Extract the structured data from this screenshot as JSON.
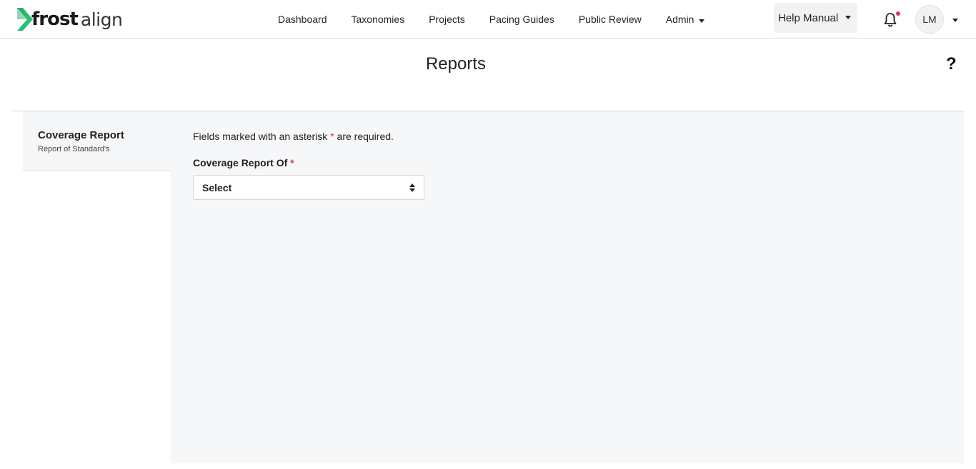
{
  "brand": {
    "name_bold": "frost",
    "name_light": "align",
    "accent_color": "#2bbf73"
  },
  "nav": {
    "items": [
      {
        "label": "Dashboard"
      },
      {
        "label": "Taxonomies"
      },
      {
        "label": "Projects"
      },
      {
        "label": "Pacing Guides"
      },
      {
        "label": "Public Review"
      },
      {
        "label": "Admin"
      }
    ]
  },
  "header": {
    "help_label": "Help Manual",
    "notification_icon": "bell-icon",
    "avatar_initials": "LM"
  },
  "page": {
    "title": "Reports",
    "help_glyph": "?"
  },
  "sidebar": {
    "items": [
      {
        "title": "Coverage Report",
        "subtitle": "Report of Standard's"
      }
    ]
  },
  "form": {
    "note_prefix": "Fields marked with an asterisk",
    "note_asterisk": "*",
    "note_suffix": "are required.",
    "field_label": "Coverage Report Of",
    "field_required_mark": "*",
    "select_value": "Select"
  },
  "colors": {
    "required": "#d9334a",
    "notification_dot": "#d6336c",
    "panel_bg": "#f6f7f9"
  }
}
